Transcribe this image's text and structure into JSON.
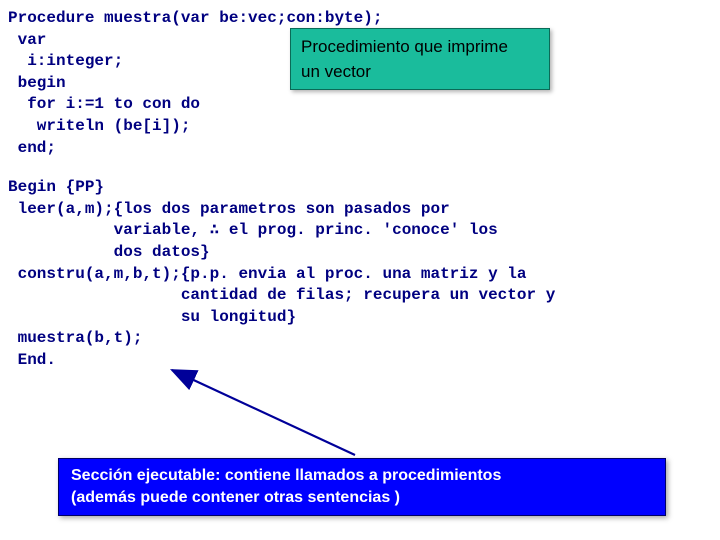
{
  "code_top": "Procedure muestra(var be:vec;con:byte);\n var\n  i:integer;\n begin\n  for i:=1 to con do\n   writeln (be[i]);\n end;",
  "code_bottom": "Begin {PP}\n leer(a,m);{los dos parametros son pasados por\n           variable, ∴ el prog. princ. 'conoce' los\n           dos datos}\n constru(a,m,b,t);{p.p. envia al proc. una matriz y la\n                  cantidad de filas; recupera un vector y\n                  su longitud}\n muestra(b,t);\n End.",
  "callout_green_line1": "Procedimiento que imprime",
  "callout_green_line2": "un vector",
  "callout_blue_line1": "Sección ejecutable: contiene llamados a  procedimientos",
  "callout_blue_line2": "(además puede contener  otras sentencias )"
}
